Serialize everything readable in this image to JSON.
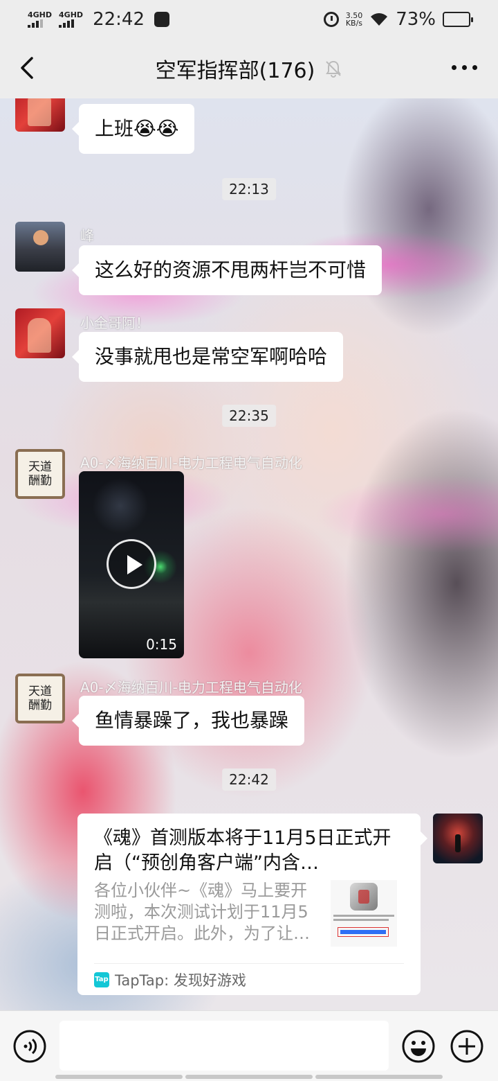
{
  "status_bar": {
    "signal1_label": "4GHD",
    "signal2_label": "4GHD",
    "time": "22:42",
    "net_speed_value": "3.50",
    "net_speed_unit": "KB/s",
    "battery_percent": "73%",
    "battery_level": 0.73
  },
  "header": {
    "title": "空军指挥部(176)"
  },
  "messages": [
    {
      "text": "上班😭😭"
    },
    {
      "timestamp": "22:13"
    },
    {
      "sender": "峰",
      "text": "这么好的资源不甩两杆岂不可惜"
    },
    {
      "sender": "小全哥阿！",
      "text": "没事就甩也是常空军啊哈哈"
    },
    {
      "timestamp": "22:35"
    },
    {
      "sender": "A0-〆海纳百川-电力工程电气自动化",
      "video_duration": "0:15"
    },
    {
      "sender": "A0-〆海纳百川-电力工程电气自动化",
      "text": "鱼情暴躁了，我也暴躁"
    },
    {
      "timestamp": "22:42"
    },
    {
      "card_title": "《魂》首测版本将于11月5日正式开启（“预创角客户端”内含…",
      "card_desc": "各位小伙伴~《魂》马上要开测啦，本次测试计划于11月5日正式开启。此外，为了让…",
      "card_source": "TapTap: 发现好游戏",
      "source_icon_label": "Tap"
    }
  ],
  "calligraphy_avatar_text": "天道酬勤",
  "colors": {
    "bubble": "#ffffff",
    "bar_background": "#ededed",
    "taptap_accent": "#13c7d6"
  },
  "icons": {
    "back": "chevron-left-icon",
    "mute": "bell-off-icon",
    "more": "more-horizontal-icon",
    "voice": "voice-icon",
    "emoji": "emoji-icon",
    "plus": "plus-circle-icon",
    "play": "play-icon"
  }
}
